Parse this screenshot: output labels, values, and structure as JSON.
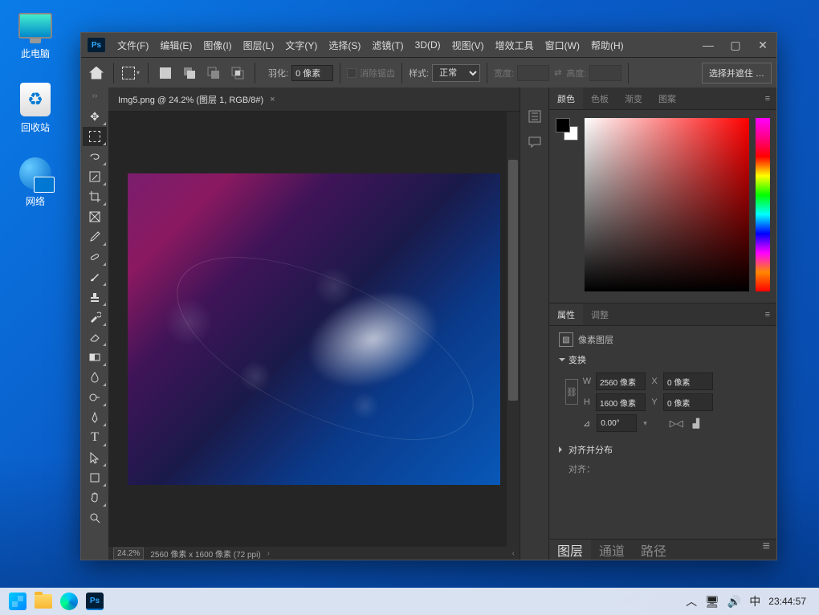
{
  "desktop": {
    "icons": {
      "this_pc": "此电脑",
      "recycle": "回收站",
      "network": "网络"
    }
  },
  "menubar": {
    "items": [
      "文件(F)",
      "编辑(E)",
      "图像(I)",
      "图层(L)",
      "文字(Y)",
      "选择(S)",
      "滤镜(T)",
      "3D(D)",
      "视图(V)",
      "增效工具",
      "窗口(W)",
      "帮助(H)"
    ]
  },
  "optbar": {
    "feather_label": "羽化:",
    "feather_value": "0 像素",
    "antialias": "消除锯齿",
    "style_label": "样式:",
    "style_value": "正常",
    "width_label": "宽度:",
    "height_label": "高度:",
    "mask_btn": "选择并遮住 …"
  },
  "document": {
    "tab_title": "Img5.png @ 24.2% (图层 1, RGB/8#)"
  },
  "statusbar": {
    "zoom": "24.2%",
    "info": "2560 像素 x 1600 像素 (72 ppi)"
  },
  "panels": {
    "color": {
      "tab_color": "颜色",
      "tab_swatches": "色板",
      "tab_gradients": "渐变",
      "tab_patterns": "图案"
    },
    "props": {
      "tab_properties": "属性",
      "tab_adjustments": "调整",
      "layer_type": "像素图层",
      "section_transform": "变换",
      "section_align": "对齐并分布",
      "align_label": "对齐：",
      "w_label": "W",
      "w_value": "2560 像素",
      "h_label": "H",
      "h_value": "1600 像素",
      "x_label": "X",
      "x_value": "0 像素",
      "y_label": "Y",
      "y_value": "0 像素",
      "angle_value": "0.00°"
    },
    "layers": {
      "tab_layers": "图层",
      "tab_channels": "通道",
      "tab_paths": "路径"
    }
  },
  "taskbar": {
    "ime": "中",
    "time": "23:44:57"
  }
}
